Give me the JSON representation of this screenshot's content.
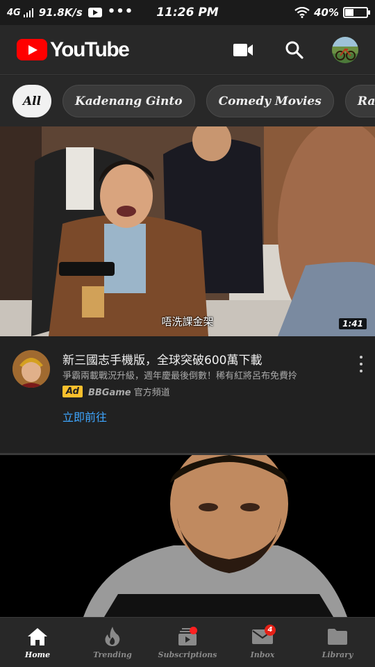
{
  "status_bar": {
    "network": "4G",
    "speed": "91.8K/s",
    "dots": "•••",
    "time": "11:26 PM",
    "battery_percent": "40%",
    "battery_level": 0.4
  },
  "header": {
    "logo_text": "YouTube",
    "icons": [
      "video-camera-icon",
      "search-icon",
      "account-avatar"
    ]
  },
  "chips": [
    {
      "label": "All",
      "active": true
    },
    {
      "label": "Kadenang Ginto",
      "active": false
    },
    {
      "label": "Comedy Movies",
      "active": false
    },
    {
      "label": "Rapping",
      "active": false
    }
  ],
  "video1": {
    "subtitle": "唔洗課金架",
    "duration": "1:41"
  },
  "ad": {
    "title": "新三國志手機版，全球突破600萬下載",
    "description": "爭霸兩載戰況升級，週年慶最後倒數！稀有紅將呂布免費拎",
    "badge": "Ad",
    "channel_brand": "BBGame",
    "channel_suffix": " 官方頻道",
    "cta": "立即前往"
  },
  "bottom_nav": [
    {
      "label": "Home",
      "icon": "home-icon",
      "active": true
    },
    {
      "label": "Trending",
      "icon": "flame-icon",
      "active": false
    },
    {
      "label": "Subscriptions",
      "icon": "subscriptions-icon",
      "active": false
    },
    {
      "label": "Inbox",
      "icon": "mail-icon",
      "active": false,
      "badge": "4"
    },
    {
      "label": "Library",
      "icon": "folder-icon",
      "active": false
    }
  ],
  "colors": {
    "background": "#212121",
    "header": "#282828",
    "brand_red": "#ff0000",
    "link_blue": "#3ea6ff",
    "ad_badge": "#fbc02d"
  }
}
